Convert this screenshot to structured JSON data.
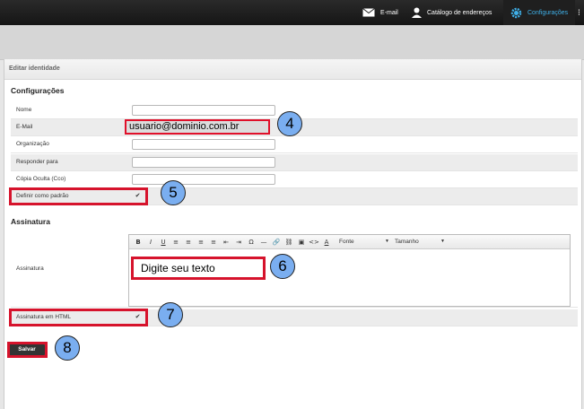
{
  "topbar": {
    "email_label": "E-mail",
    "contacts_label": "Catálogo de endereços",
    "settings_label": "Configurações",
    "more_label": "⁝"
  },
  "panel": {
    "header_title": "Editar identidade",
    "config_section_title": "Configurações",
    "signature_section_title": "Assinatura"
  },
  "fields": {
    "name_label": "Nome",
    "email_label": "E-Mail",
    "email_value": "usuario@dominio.com.br",
    "org_label": "Organização",
    "reply_label": "Responder para",
    "bcc_label": "Cópia Oculta (Cco)",
    "default_label": "Definir como padrão",
    "signature_label": "Assinatura",
    "html_signature_label": "Assinatura em HTML"
  },
  "editor": {
    "font_label": "Fonte",
    "size_label": "Tamanho",
    "placeholder_text": "Digite seu texto",
    "toolbar_buttons": [
      "B",
      "I",
      "U",
      "≡",
      "≡",
      "≡",
      "≡",
      "⇤",
      "⇥",
      "Ω",
      "—",
      "🔗",
      "⛓",
      "▣",
      "<>",
      "A"
    ]
  },
  "buttons": {
    "save_label": "Salvar"
  },
  "callouts": {
    "n4": "4",
    "n5": "5",
    "n6": "6",
    "n7": "7",
    "n8": "8"
  },
  "colors": {
    "accent": "#3fb0e8",
    "highlight": "#d6132c",
    "callout_fill": "#7aaef0"
  }
}
